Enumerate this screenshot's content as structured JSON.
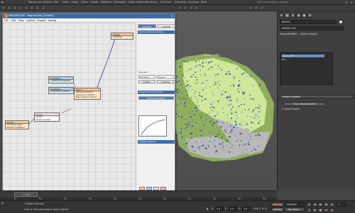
{
  "app": {
    "title": "Workspace: Default",
    "menus": [
      "Edit",
      "Tools",
      "Group",
      "Views",
      "Create",
      "Modifiers",
      "Animation",
      "Graph Editors",
      "Rendering",
      "Civil View",
      "Customize",
      "Scripting",
      "Help"
    ],
    "search_placeholder": "Type a keyword or phrase"
  },
  "magma_flow": {
    "title": "MAGMAFLOW - MagmaFlow [Untitled]",
    "menus": [
      "File",
      "Edit",
      "View",
      "Options",
      "Expose",
      "Debug"
    ],
    "nodes": {
      "output": {
        "title": "Output",
        "row": "Float4(0)"
      },
      "input_a": {
        "title": "InputValue",
        "row": "0.000100 0.200000..."
      },
      "input_b": {
        "title": "InputValue",
        "row": "0.100000 0.200000..."
      },
      "blend": {
        "title": "Blend",
        "rows": [
          "Value A1 (Vector)",
          "Value A1 2 (Vector)",
          "Blend Amount (Scal)"
        ]
      },
      "curve": {
        "title": "Curve",
        "rows": [
          "Curve",
          "Scalar (Scalar)"
        ]
      },
      "divide": {
        "title": "Divide",
        "rows": [
          "Dividend (Age)",
          "Divisor (LifeSpan)"
        ]
      }
    },
    "side": {
      "tabs": [
        "EDITOR",
        "UPDATE"
      ],
      "name_section": "Name and Color Notes",
      "category_label": "Operator:",
      "category_value": "Function",
      "operator_value": "Curve",
      "enable_btn": "Enable",
      "collapse_btn": "Collapse",
      "props_section": "Properties and Actions",
      "curve_btn": "Edit Curve Editor",
      "display_section": "Display Options"
    }
  },
  "viewport": {
    "label": "Count: 24867",
    "colors": {
      "terrain": "#cfe79a",
      "terrain_dark": "#8fae5e",
      "rock": "#b9b9b9",
      "particle": "#2e3a9a",
      "particle_light": "#4a6ad0"
    }
  },
  "command_panel": {
    "object_name": "Box001",
    "modifier_list": "Modifier List",
    "stack_header": "MagmaModifier - Lafabuy Selects",
    "stack_items": [
      "Magma_PFT",
      "Box"
    ],
    "rollout": "Magma Modifier",
    "open_editor_btn": "Open Magma Editor",
    "auto_rename": "Auto Rename"
  },
  "timeline": {
    "slider": "0 / 100",
    "ticks": [
      "0",
      "10",
      "20",
      "30",
      "40",
      "50",
      "60",
      "70",
      "80",
      "90",
      "100"
    ]
  },
  "status": {
    "left": "1 Object Selected",
    "prompt": "Click or click-and-drag to select objects",
    "coords": {
      "x_label": "X:",
      "x": "0.0",
      "y_label": "Y:",
      "y": "0.0",
      "z_label": "Z:",
      "z": "0.0"
    },
    "grid": "Grid = 10.0",
    "auto_key": "Auto Key",
    "selected": "Selected",
    "set_key": "Set Key",
    "key_filters": "Key Filters...",
    "frame": "0"
  }
}
